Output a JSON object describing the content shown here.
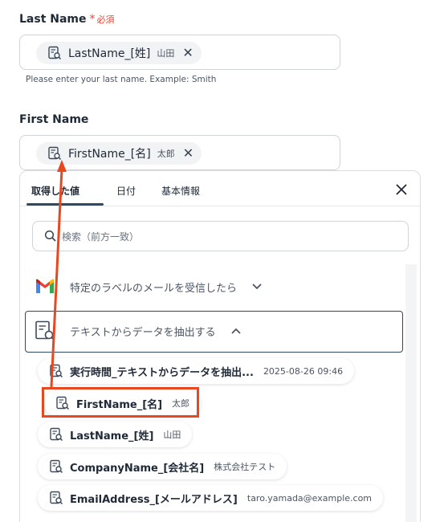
{
  "last_name": {
    "label": "Last Name",
    "required_star": "*",
    "required_text": "必須",
    "chip": {
      "name": "LastName_[姓]",
      "value": "山田"
    },
    "hint": "Please enter your last name. Example: Smith"
  },
  "first_name": {
    "label": "First Name",
    "chip": {
      "name": "FirstName_[名]",
      "value": "太郎"
    }
  },
  "panel": {
    "tabs": [
      {
        "label": "取得した値",
        "active": true
      },
      {
        "label": "日付",
        "active": false
      },
      {
        "label": "基本情報",
        "active": false
      }
    ],
    "search_placeholder": "検索（前方一致）",
    "groups": [
      {
        "title": "特定のラベルのメールを受信したら",
        "icon": "gmail-icon",
        "expanded": false
      },
      {
        "title": "テキストからデータを抽出する",
        "icon": "document-search-icon",
        "expanded": true
      }
    ],
    "items": [
      {
        "name": "実行時間_テキストからデータを抽出...",
        "value": "2025-08-26 09:46"
      },
      {
        "name": "FirstName_[名]",
        "value": "太郎"
      },
      {
        "name": "LastName_[姓]",
        "value": "山田"
      },
      {
        "name": "CompanyName_[会社名]",
        "value": "株式会社テスト"
      },
      {
        "name": "EmailAddress_[メールアドレス]",
        "value": "taro.yamada@example.com"
      }
    ]
  },
  "colors": {
    "accent_navy": "#2e4a63",
    "annotation_red": "#e8481f",
    "required_red": "#e5483b"
  }
}
